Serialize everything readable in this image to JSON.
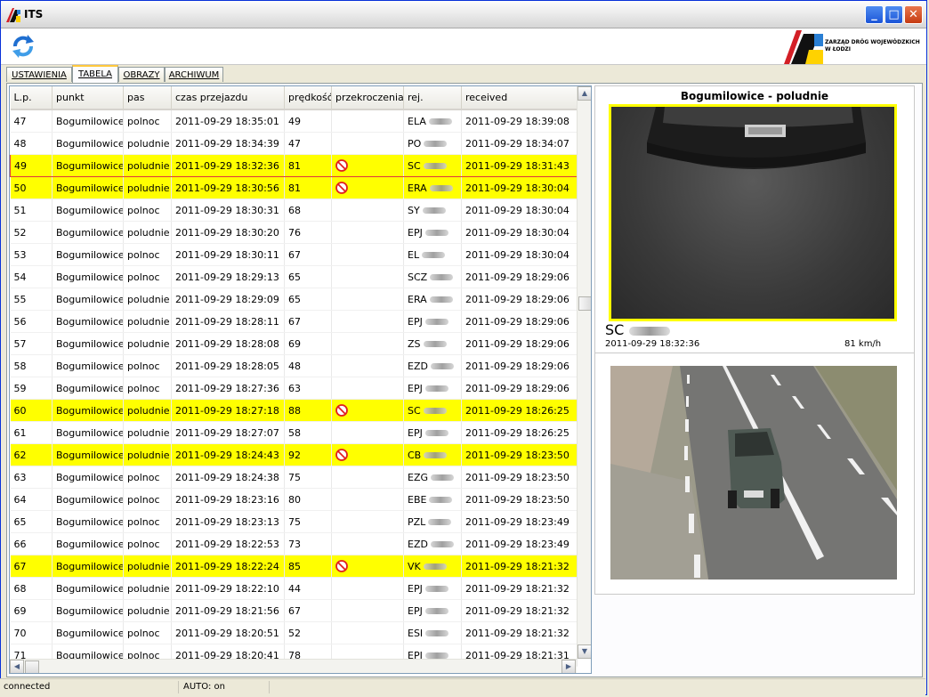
{
  "window": {
    "title": "ITS"
  },
  "logo": {
    "name": "ZARZĄD DRÓG WOJEWÓDZKICH W ŁODZI"
  },
  "tabs": [
    {
      "label": "USTAWIENIA"
    },
    {
      "label": "TABELA"
    },
    {
      "label": "OBRAZY"
    },
    {
      "label": "ARCHIWUM"
    }
  ],
  "table": {
    "columns": [
      "L.p.",
      "punkt",
      "pas",
      "czas przejazdu",
      "prędkość",
      "przekroczenia",
      "rej.",
      "received"
    ],
    "rows": [
      {
        "lp": "47",
        "punkt": "Bogumilowice",
        "pas": "polnoc",
        "czas": "2011-09-29 18:35:01",
        "predkosc": "49",
        "viol": false,
        "rej": "ELA",
        "received": "2011-09-29 18:39:08"
      },
      {
        "lp": "48",
        "punkt": "Bogumilowice",
        "pas": "poludnie",
        "czas": "2011-09-29 18:34:39",
        "predkosc": "47",
        "viol": false,
        "rej": "PO",
        "received": "2011-09-29 18:34:07"
      },
      {
        "lp": "49",
        "punkt": "Bogumilowice",
        "pas": "poludnie",
        "czas": "2011-09-29 18:32:36",
        "predkosc": "81",
        "viol": true,
        "rej": "SC",
        "received": "2011-09-29 18:31:43"
      },
      {
        "lp": "50",
        "punkt": "Bogumilowice",
        "pas": "poludnie",
        "czas": "2011-09-29 18:30:56",
        "predkosc": "81",
        "viol": true,
        "rej": "ERA",
        "received": "2011-09-29 18:30:04"
      },
      {
        "lp": "51",
        "punkt": "Bogumilowice",
        "pas": "polnoc",
        "czas": "2011-09-29 18:30:31",
        "predkosc": "68",
        "viol": false,
        "rej": "SY",
        "received": "2011-09-29 18:30:04"
      },
      {
        "lp": "52",
        "punkt": "Bogumilowice",
        "pas": "poludnie",
        "czas": "2011-09-29 18:30:20",
        "predkosc": "76",
        "viol": false,
        "rej": "EPJ",
        "received": "2011-09-29 18:30:04"
      },
      {
        "lp": "53",
        "punkt": "Bogumilowice",
        "pas": "polnoc",
        "czas": "2011-09-29 18:30:11",
        "predkosc": "67",
        "viol": false,
        "rej": "EL",
        "received": "2011-09-29 18:30:04"
      },
      {
        "lp": "54",
        "punkt": "Bogumilowice",
        "pas": "polnoc",
        "czas": "2011-09-29 18:29:13",
        "predkosc": "65",
        "viol": false,
        "rej": "SCZ",
        "received": "2011-09-29 18:29:06"
      },
      {
        "lp": "55",
        "punkt": "Bogumilowice",
        "pas": "poludnie",
        "czas": "2011-09-29 18:29:09",
        "predkosc": "65",
        "viol": false,
        "rej": "ERA",
        "received": "2011-09-29 18:29:06"
      },
      {
        "lp": "56",
        "punkt": "Bogumilowice",
        "pas": "poludnie",
        "czas": "2011-09-29 18:28:11",
        "predkosc": "67",
        "viol": false,
        "rej": "EPJ",
        "received": "2011-09-29 18:29:06"
      },
      {
        "lp": "57",
        "punkt": "Bogumilowice",
        "pas": "poludnie",
        "czas": "2011-09-29 18:28:08",
        "predkosc": "69",
        "viol": false,
        "rej": "ZS",
        "received": "2011-09-29 18:29:06"
      },
      {
        "lp": "58",
        "punkt": "Bogumilowice",
        "pas": "polnoc",
        "czas": "2011-09-29 18:28:05",
        "predkosc": "48",
        "viol": false,
        "rej": "EZD",
        "received": "2011-09-29 18:29:06"
      },
      {
        "lp": "59",
        "punkt": "Bogumilowice",
        "pas": "polnoc",
        "czas": "2011-09-29 18:27:36",
        "predkosc": "63",
        "viol": false,
        "rej": "EPJ",
        "received": "2011-09-29 18:29:06"
      },
      {
        "lp": "60",
        "punkt": "Bogumilowice",
        "pas": "poludnie",
        "czas": "2011-09-29 18:27:18",
        "predkosc": "88",
        "viol": true,
        "rej": "SC",
        "received": "2011-09-29 18:26:25"
      },
      {
        "lp": "61",
        "punkt": "Bogumilowice",
        "pas": "poludnie",
        "czas": "2011-09-29 18:27:07",
        "predkosc": "58",
        "viol": false,
        "rej": "EPJ",
        "received": "2011-09-29 18:26:25"
      },
      {
        "lp": "62",
        "punkt": "Bogumilowice",
        "pas": "poludnie",
        "czas": "2011-09-29 18:24:43",
        "predkosc": "92",
        "viol": true,
        "rej": "CB",
        "received": "2011-09-29 18:23:50"
      },
      {
        "lp": "63",
        "punkt": "Bogumilowice",
        "pas": "polnoc",
        "czas": "2011-09-29 18:24:38",
        "predkosc": "75",
        "viol": false,
        "rej": "EZG",
        "received": "2011-09-29 18:23:50"
      },
      {
        "lp": "64",
        "punkt": "Bogumilowice",
        "pas": "polnoc",
        "czas": "2011-09-29 18:23:16",
        "predkosc": "80",
        "viol": false,
        "rej": "EBE",
        "received": "2011-09-29 18:23:50"
      },
      {
        "lp": "65",
        "punkt": "Bogumilowice",
        "pas": "polnoc",
        "czas": "2011-09-29 18:23:13",
        "predkosc": "75",
        "viol": false,
        "rej": "PZL",
        "received": "2011-09-29 18:23:49"
      },
      {
        "lp": "66",
        "punkt": "Bogumilowice",
        "pas": "polnoc",
        "czas": "2011-09-29 18:22:53",
        "predkosc": "73",
        "viol": false,
        "rej": "EZD",
        "received": "2011-09-29 18:23:49"
      },
      {
        "lp": "67",
        "punkt": "Bogumilowice",
        "pas": "poludnie",
        "czas": "2011-09-29 18:22:24",
        "predkosc": "85",
        "viol": true,
        "rej": "VK",
        "received": "2011-09-29 18:21:32"
      },
      {
        "lp": "68",
        "punkt": "Bogumilowice",
        "pas": "poludnie",
        "czas": "2011-09-29 18:22:10",
        "predkosc": "44",
        "viol": false,
        "rej": "EPJ",
        "received": "2011-09-29 18:21:32"
      },
      {
        "lp": "69",
        "punkt": "Bogumilowice",
        "pas": "poludnie",
        "czas": "2011-09-29 18:21:56",
        "predkosc": "67",
        "viol": false,
        "rej": "EPJ",
        "received": "2011-09-29 18:21:32"
      },
      {
        "lp": "70",
        "punkt": "Bogumilowice",
        "pas": "polnoc",
        "czas": "2011-09-29 18:20:51",
        "predkosc": "52",
        "viol": false,
        "rej": "ESI",
        "received": "2011-09-29 18:21:32"
      },
      {
        "lp": "71",
        "punkt": "Bogumilowice",
        "pas": "polnoc",
        "czas": "2011-09-29 18:20:41",
        "predkosc": "78",
        "viol": false,
        "rej": "EPJ",
        "received": "2011-09-29 18:21:31"
      }
    ],
    "selected_lp": "49",
    "violation_color": "#ffff00",
    "selection_color": "#e0393e"
  },
  "camera": {
    "title": "Bogumilowice - poludnie",
    "plate": "SC",
    "time": "2011-09-29 18:32:36",
    "speed": "81 km/h",
    "frame_color": "#ffff00"
  },
  "status": {
    "connection": "connected",
    "auto": "AUTO: on"
  },
  "icons": {
    "violation": "no-entry-icon",
    "refresh": "refresh-icon"
  }
}
